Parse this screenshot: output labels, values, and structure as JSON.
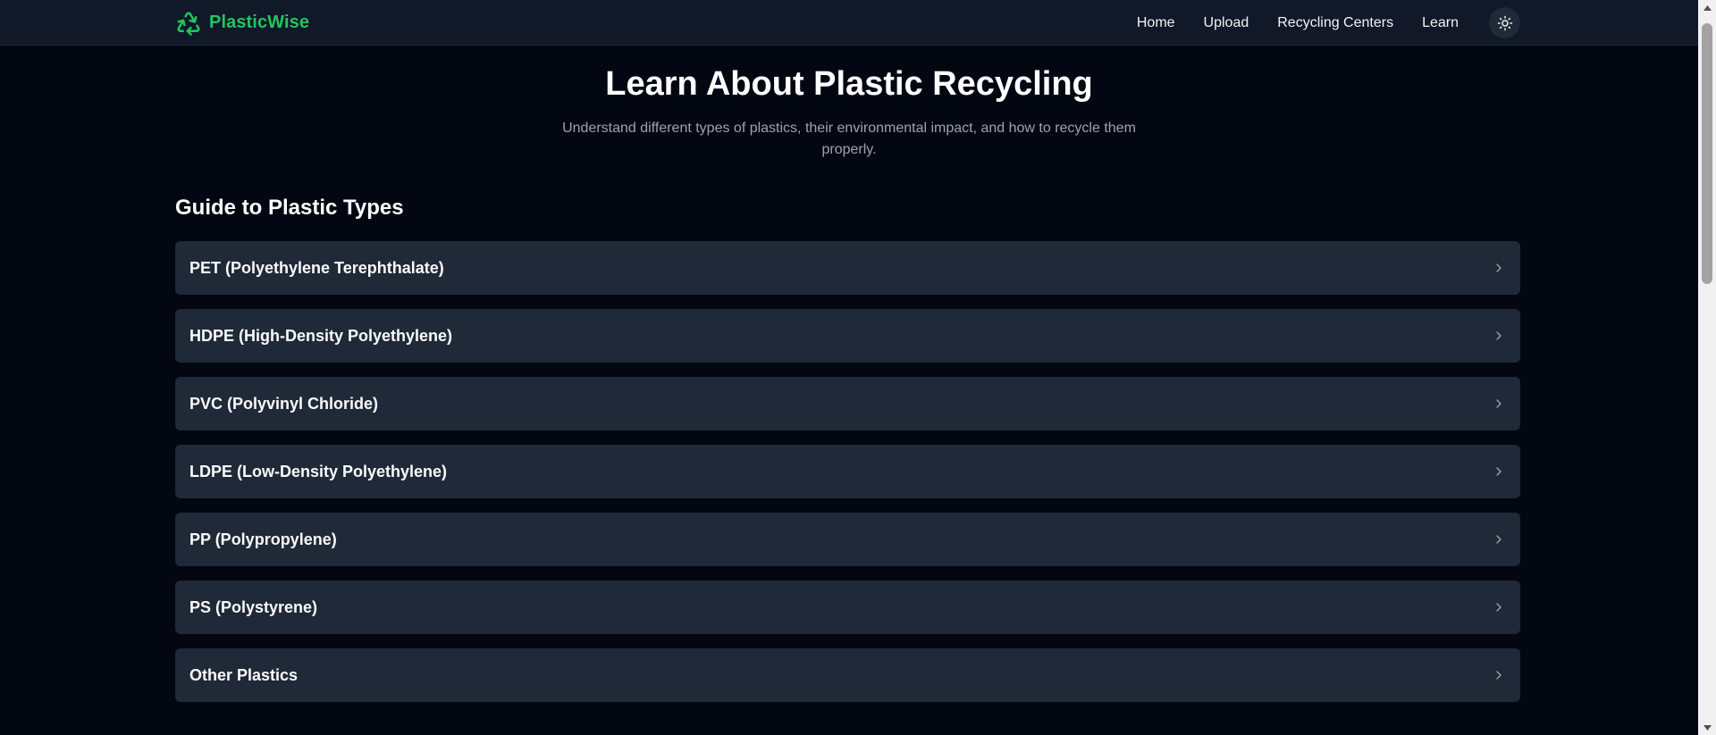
{
  "header": {
    "brand_name": "PlasticWise",
    "nav": [
      {
        "label": "Home"
      },
      {
        "label": "Upload"
      },
      {
        "label": "Recycling Centers"
      },
      {
        "label": "Learn"
      }
    ],
    "accent_color": "#22c55e"
  },
  "hero": {
    "title": "Learn About Plastic Recycling",
    "subtitle": "Understand different types of plastics, their environmental impact, and how to recycle them properly."
  },
  "guide": {
    "heading": "Guide to Plastic Types",
    "items": [
      {
        "title": "PET (Polyethylene Terephthalate)"
      },
      {
        "title": "HDPE (High-Density Polyethylene)"
      },
      {
        "title": "PVC (Polyvinyl Chloride)"
      },
      {
        "title": "LDPE (Low-Density Polyethylene)"
      },
      {
        "title": "PP (Polypropylene)"
      },
      {
        "title": "PS (Polystyrene)"
      },
      {
        "title": "Other Plastics"
      }
    ]
  },
  "icons": {
    "brand": "recycle-icon",
    "theme": "sun-icon",
    "accordion": "chevron-right-icon"
  }
}
